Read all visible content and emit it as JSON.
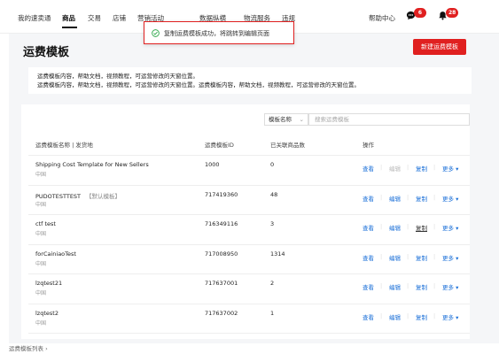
{
  "nav": {
    "items": [
      "我的速卖通",
      "商品",
      "交易",
      "店铺",
      "营销活动",
      "数据纵横",
      "物流服务",
      "违规"
    ],
    "help": "帮助中心",
    "messages_badge": "6",
    "notifications_badge": "28"
  },
  "toast": {
    "text": "复制运费模板成功，将跳转到编辑页面"
  },
  "page": {
    "title": "运费模板",
    "new_button": "新建运费模板",
    "desc_line1": "运费模板内容，帮助文档，视频教程，可运营修改的天窗位置。",
    "desc_line2": "运费模板内容，帮助文档，视频教程，可运营修改的天窗位置。运费模板内容，帮助文档，视频教程，可运营修改的天窗位置。"
  },
  "filter": {
    "select_value": "模板名称",
    "search_placeholder": "搜索运费模板"
  },
  "table": {
    "headers": [
      "运费模板名称 | 发货地",
      "运费模板ID",
      "已关联商品数",
      "操作"
    ],
    "action_labels": {
      "view": "查看",
      "edit": "编辑",
      "copy": "复制",
      "more": "更多"
    },
    "rows": [
      {
        "name": "Shipping Cost Template for New Sellers",
        "tag": "",
        "country": "中国",
        "id": "1000",
        "count": "0",
        "edit_disabled": true
      },
      {
        "name": "PUDOTESTTEST",
        "tag": "【默认模板】",
        "country": "中国",
        "id": "717419360",
        "count": "48",
        "edit_disabled": false
      },
      {
        "name": "ctf test",
        "tag": "",
        "country": "中国",
        "id": "716349116",
        "count": "3",
        "edit_disabled": false
      },
      {
        "name": "forCainiaoTest",
        "tag": "",
        "country": "中国",
        "id": "717008950",
        "count": "1314",
        "edit_disabled": false
      },
      {
        "name": "lzqtest21",
        "tag": "",
        "country": "中国",
        "id": "717637001",
        "count": "2",
        "edit_disabled": false
      },
      {
        "name": "lzqtest2",
        "tag": "",
        "country": "中国",
        "id": "717637002",
        "count": "1",
        "edit_disabled": false
      }
    ]
  },
  "breadcrumb": "运费模板列表",
  "colors": {
    "accent": "#e02020",
    "link": "#1a6fd8"
  }
}
